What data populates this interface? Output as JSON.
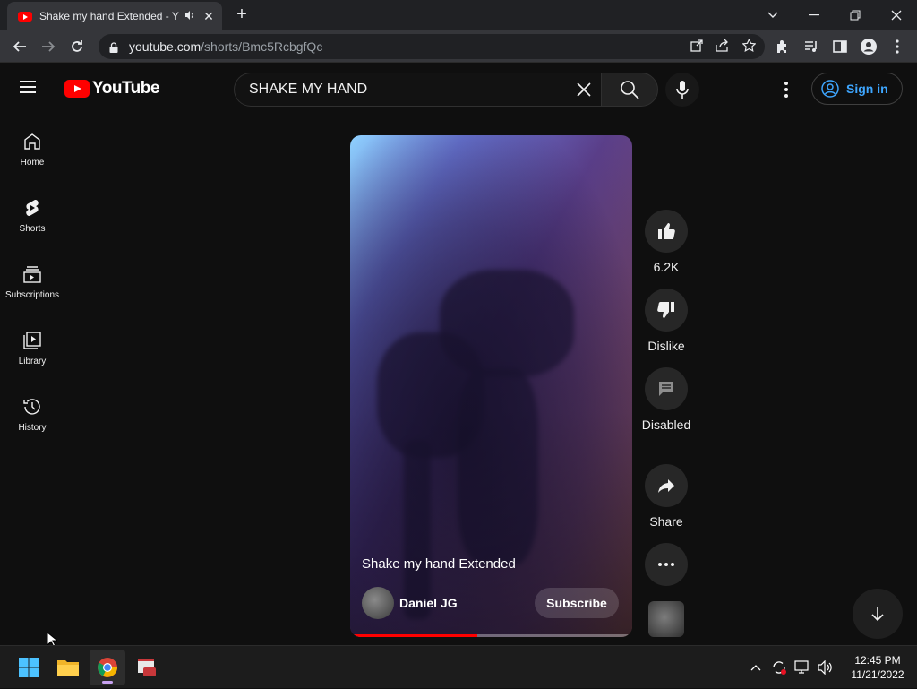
{
  "browser": {
    "tab_title": "Shake my hand Extended - Y",
    "url_host": "youtube.com",
    "url_path": "/shorts/Bmc5RcbgfQc"
  },
  "youtube": {
    "logo_text": "YouTube",
    "search_value": "SHAKE MY HAND",
    "signin_label": "Sign in"
  },
  "sidenav": {
    "items": [
      {
        "label": "Home",
        "icon": "home-icon"
      },
      {
        "label": "Shorts",
        "icon": "shorts-icon"
      },
      {
        "label": "Subscriptions",
        "icon": "subscriptions-icon"
      },
      {
        "label": "Library",
        "icon": "library-icon"
      },
      {
        "label": "History",
        "icon": "history-icon"
      }
    ]
  },
  "video": {
    "title": "Shake my hand Extended",
    "channel": "Daniel JG",
    "subscribe_label": "Subscribe",
    "progress_fraction": 0.45
  },
  "actions": {
    "like_count": "6.2K",
    "dislike_label": "Dislike",
    "comments_label": "Disabled",
    "share_label": "Share"
  },
  "taskbar": {
    "time": "12:45 PM",
    "date": "11/21/2022"
  },
  "colors": {
    "accent_red": "#ff0000",
    "signin_blue": "#3ea6ff",
    "background": "#0f0f0f"
  }
}
